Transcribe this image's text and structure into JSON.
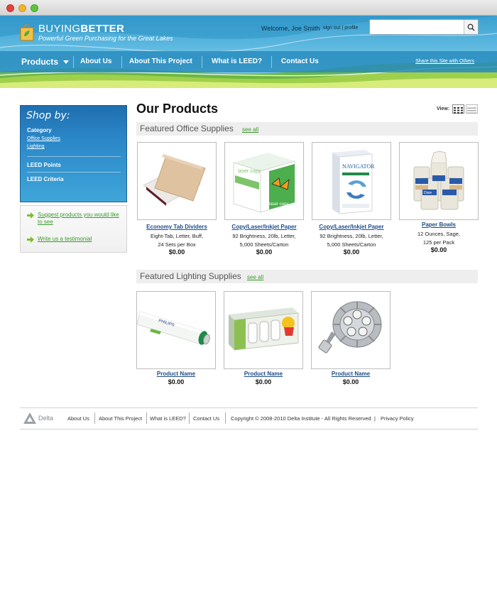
{
  "site": {
    "brand_bold": "BUYING",
    "brand_light": "BETTER",
    "tagline": "Powerful Green Purchasing for the Great Lakes"
  },
  "account": {
    "welcome": "Welcome, Joe Smith",
    "sign_out": "sign out",
    "separator": "|",
    "profile": "profile"
  },
  "search": {
    "placeholder": "",
    "value": ""
  },
  "nav": {
    "products": "Products",
    "about_us": "About Us",
    "about_project": "About This Project",
    "leed": "What is LEED?",
    "contact": "Contact Us",
    "share": "Share this Site with Others"
  },
  "sidebar": {
    "title": "Shop by:",
    "category_heading": "Category",
    "category_links": [
      "Office Supplies",
      "Lighting"
    ],
    "leed_points": "LEED Points",
    "leed_criteria": "LEED Criteria",
    "suggest_link": "Suggest  products you would like to see",
    "testimonial_link": "Write us a testimonial"
  },
  "main": {
    "title": "Our Products",
    "view_label": "View:"
  },
  "office_section": {
    "title": "Featured Office Supplies",
    "see_all": "see all",
    "products": [
      {
        "name": "Economy Tab Dividers",
        "desc1": "Eight-Tab, Letter, Buff,",
        "desc2": "24 Sets per Box",
        "price": "$0.00"
      },
      {
        "name": "Copy/Laser/Inkjet Paper",
        "desc1": "92 Brightness, 20lb, Letter,",
        "desc2": "5,000 Sheets/Carton",
        "price": "$0.00"
      },
      {
        "name": "Copy/Laser/Inkjet Paper",
        "desc1": "92 Brightness, 20lb, Letter,",
        "desc2": "5,000 Sheets/Carton",
        "price": "$0.00"
      },
      {
        "name": "Paper Bowls",
        "desc1": "12 Ounces, Sage,",
        "desc2": "125 per Pack",
        "price": "$0.00"
      }
    ]
  },
  "lighting_section": {
    "title": "Featured Lighting Supplies",
    "see_all": "see all",
    "products": [
      {
        "name": "Product Name",
        "price": "$0.00"
      },
      {
        "name": "Product Name",
        "price": "$0.00"
      },
      {
        "name": "Product Name",
        "price": "$0.00"
      }
    ]
  },
  "product_art": {
    "paper_brand_1": "laser copy",
    "paper_brand_2": "NAVIGATOR",
    "bowl_brand": "Dixie",
    "tube_brand": "PHILIPS"
  },
  "footer": {
    "logo_text": "Delta",
    "links": [
      "About Us",
      "About This Project",
      "What is LEED?",
      "Contact Us"
    ],
    "copyright": "Copyright © 2008-2010 Delta Institute - All Rights Reserved",
    "separator": "|",
    "privacy": "Privacy Policy"
  },
  "colors": {
    "header_blue": "#3aa0cf",
    "nav_blue": "#288cbe",
    "link_green": "#3a9a2a",
    "product_link_blue": "#1e4c8a"
  }
}
